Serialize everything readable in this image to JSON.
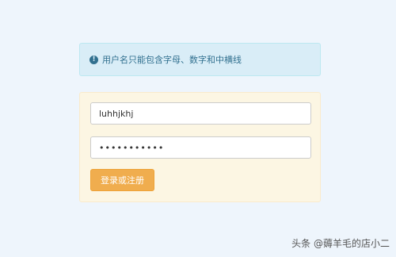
{
  "alert": {
    "icon": "exclamation-circle-icon",
    "message": "用户名只能包含字母、数字和中横线"
  },
  "form": {
    "username_value": "luhhjkhj",
    "password_value": "•••••••••••",
    "submit_label": "登录或注册"
  },
  "watermark": {
    "text": "头条 @薅羊毛的店小二"
  },
  "colors": {
    "page_background": "#eef5fc",
    "alert_background": "#d9edf7",
    "alert_text": "#31708f",
    "panel_background": "#fcf6e3",
    "button_background": "#f0ad4e"
  }
}
